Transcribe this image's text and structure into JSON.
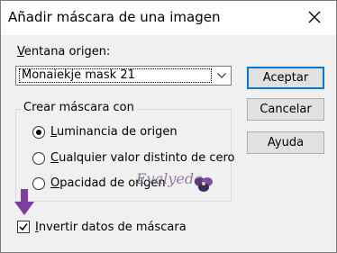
{
  "window": {
    "title": "Añadir máscara de una imagen"
  },
  "source": {
    "label_underlined": "V",
    "label_rest": "entana origen:",
    "selected_value": "Monaiekje mask 21"
  },
  "buttons": {
    "accept": "Aceptar",
    "cancel": "Cancelar",
    "help": "Ayuda"
  },
  "create_mask": {
    "legend": "Crear máscara con",
    "options": [
      {
        "u": "L",
        "rest": "uminancia de origen",
        "selected": true
      },
      {
        "u": "C",
        "rest": "ualquier valor distinto de cero",
        "selected": false
      },
      {
        "u": "O",
        "rest": "pacidad de origen",
        "selected": false
      }
    ]
  },
  "invert": {
    "label_underlined": "I",
    "label_rest": "nvertir datos de máscara",
    "checked": true
  },
  "watermark": "Evalyeda",
  "colors": {
    "accent_border": "#0078d7",
    "annotation_arrow": "#7b3fa0"
  }
}
